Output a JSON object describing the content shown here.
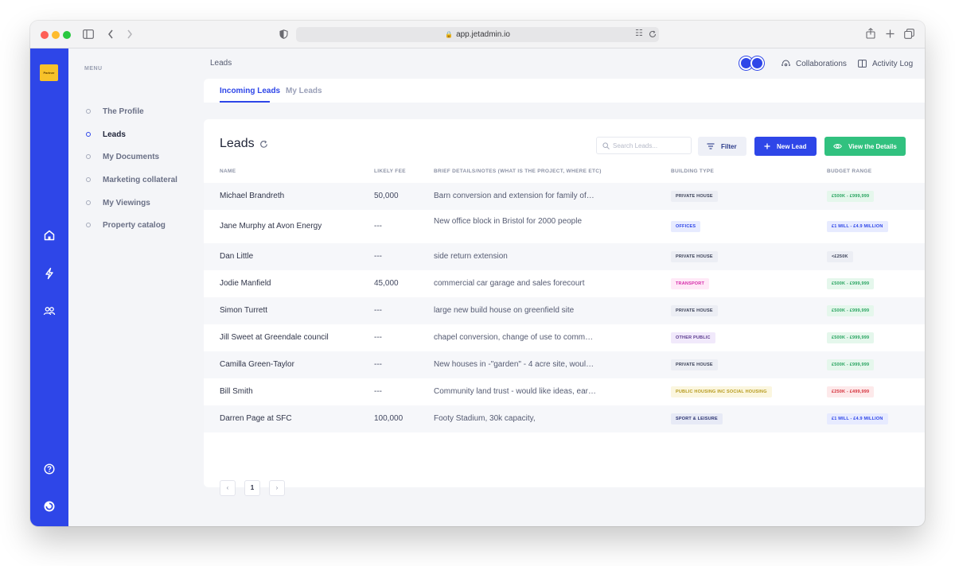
{
  "browser": {
    "url": "app.jetadmin.io"
  },
  "brand": {
    "logo_text": "Partner"
  },
  "menu": {
    "label": "MENU",
    "items": [
      {
        "label": "The Profile",
        "active": false
      },
      {
        "label": "Leads",
        "active": true
      },
      {
        "label": "My Documents",
        "active": false
      },
      {
        "label": "Marketing collateral",
        "active": false
      },
      {
        "label": "My Viewings",
        "active": false
      },
      {
        "label": "Property catalog",
        "active": false
      }
    ]
  },
  "header": {
    "breadcrumb": "Leads",
    "collaborations": "Collaborations",
    "activity_log": "Activity Log"
  },
  "tabs": [
    {
      "label": "Incoming Leads",
      "active": true
    },
    {
      "label": "My Leads",
      "active": false
    }
  ],
  "main": {
    "title": "Leads",
    "search_placeholder": "Search Leads...",
    "filter_label": "Filter",
    "new_label": "New Lead",
    "view_label": "View the Details"
  },
  "table": {
    "columns": [
      "NAME",
      "LIKELY FEE",
      "BRIEF DETAILS/NOTES (WHAT IS THE PROJECT, WHERE ETC)",
      "BUILDING TYPE",
      "BUDGET RANGE"
    ],
    "rows": [
      {
        "name": "Michael Brandreth",
        "fee": "50,000",
        "notes": "Barn conversion and extension for family of 5...",
        "building": "PRIVATE HOUSE",
        "budget": "£500K - £999,999"
      },
      {
        "name": "Jane Murphy at Avon Energy",
        "fee": "---",
        "notes": "New office block in Bristol for 2000 people",
        "building": "OFFICES",
        "budget": "£1 MILL - £4.9 MILLION"
      },
      {
        "name": "Dan Little",
        "fee": "---",
        "notes": "side return extension",
        "building": "PRIVATE HOUSE",
        "budget": "<£250K"
      },
      {
        "name": "Jodie Manfield",
        "fee": "45,000",
        "notes": "commercial car garage and sales forecourt",
        "building": "TRANSPORT",
        "budget": "£500K - £999,999"
      },
      {
        "name": "Simon Turrett",
        "fee": "---",
        "notes": "large new build house on greenfield site",
        "building": "PRIVATE HOUSE",
        "budget": "£500K - £999,999"
      },
      {
        "name": "Jill Sweet at Greendale council",
        "fee": "---",
        "notes": "chapel conversion, change of use to commun...",
        "building": "OTHER PUBLIC",
        "budget": "£500K - £999,999"
      },
      {
        "name": "Camilla Green-Taylor",
        "fee": "---",
        "notes": "New houses in -\"garden\" - 4 acre site, would l...",
        "building": "PRIVATE HOUSE",
        "budget": "£500K - £999,999"
      },
      {
        "name": "Bill Smith",
        "fee": "---",
        "notes": "Community land trust - would like ideas, earl...",
        "building": "PUBLIC HOUSING INC SOCIAL HOUSING",
        "budget": "£250K - £499,999"
      },
      {
        "name": "Darren Page at SFC",
        "fee": "100,000",
        "notes": "Footy Stadium, 30k capacity,",
        "building": "SPORT & LEISURE",
        "budget": "£1 MILL - £4.9 MILLION"
      }
    ]
  },
  "pagination": {
    "prev": "‹",
    "page": "1",
    "next": "›"
  },
  "colors": {
    "accent": "#2e46e8",
    "green": "#31c17f",
    "badge_private_house": "#eceef4",
    "badge_offices": "#e7ebff",
    "badge_transport": "#ffe9f7",
    "badge_other_public": "#f1e9fb",
    "badge_public_housing": "#fbf6df",
    "badge_sport": "#e7eaf6",
    "budget_green": "#e5f7ec",
    "budget_blue": "#e7ebff",
    "budget_red": "#fde9ea",
    "budget_grey": "#eceef4"
  }
}
